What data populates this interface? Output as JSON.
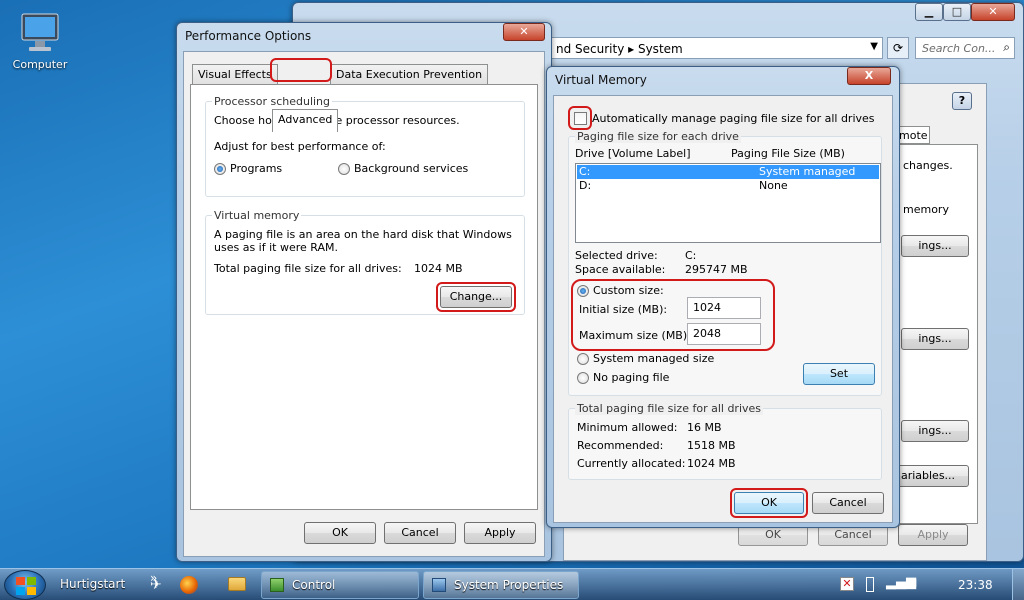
{
  "desktop": {
    "computer_label": "Computer"
  },
  "bg_window": {
    "breadcrumb": "nd Security  ▸  System",
    "search_placeholder": "Search Con...",
    "tab_remote": "mote",
    "changes_text": "changes.",
    "memory_text": "memory",
    "settings1": "ings...",
    "settings2": "ings...",
    "settings3": "ings...",
    "env_vars": "ariables...",
    "ok": "OK",
    "cancel": "Cancel",
    "apply": "Apply",
    "help": "?"
  },
  "perf": {
    "title": "Performance Options",
    "tabs": [
      "Visual Effects",
      "Advanced",
      "Data Execution Prevention"
    ],
    "proc_group": "Processor scheduling",
    "proc_desc": "Choose how to allocate processor resources.",
    "adjust_label": "Adjust for best performance of:",
    "opt_programs": "Programs",
    "opt_background": "Background services",
    "vm_group": "Virtual memory",
    "vm_desc": "A paging file is an area on the hard disk that Windows uses as if it were RAM.",
    "total_label": "Total paging file size for all drives:",
    "total_value": "1024 MB",
    "change_btn": "Change...",
    "ok": "OK",
    "cancel": "Cancel",
    "apply": "Apply"
  },
  "vm": {
    "title": "Virtual Memory",
    "close": "X",
    "auto_label": "Automatically manage paging file size for all drives",
    "each_drive_group": "Paging file size for each drive",
    "col_drive": "Drive  [Volume Label]",
    "col_size": "Paging File Size (MB)",
    "drives": [
      {
        "drive": "C:",
        "size": "System managed"
      },
      {
        "drive": "D:",
        "size": "None"
      }
    ],
    "selected_drive_label": "Selected drive:",
    "selected_drive_value": "C:",
    "space_label": "Space available:",
    "space_value": "295747 MB",
    "custom_label": "Custom size:",
    "initial_label": "Initial size (MB):",
    "initial_value": "1024",
    "max_label": "Maximum size (MB):",
    "max_value": "2048",
    "system_managed_label": "System managed size",
    "no_paging_label": "No paging file",
    "set_btn": "Set",
    "total_group": "Total paging file size for all drives",
    "min_label": "Minimum allowed:",
    "min_value": "16 MB",
    "rec_label": "Recommended:",
    "rec_value": "1518 MB",
    "cur_label": "Currently allocated:",
    "cur_value": "1024 MB",
    "ok": "OK",
    "cancel": "Cancel"
  },
  "taskbar": {
    "start_label": "Hurtigstart",
    "chevron": "»",
    "tasks": [
      "Control Panel\\Syste...",
      "System Properties"
    ],
    "clock": "23:38"
  },
  "colors": {
    "highlight": "#3399ff",
    "annotation": "#d21a1a"
  }
}
